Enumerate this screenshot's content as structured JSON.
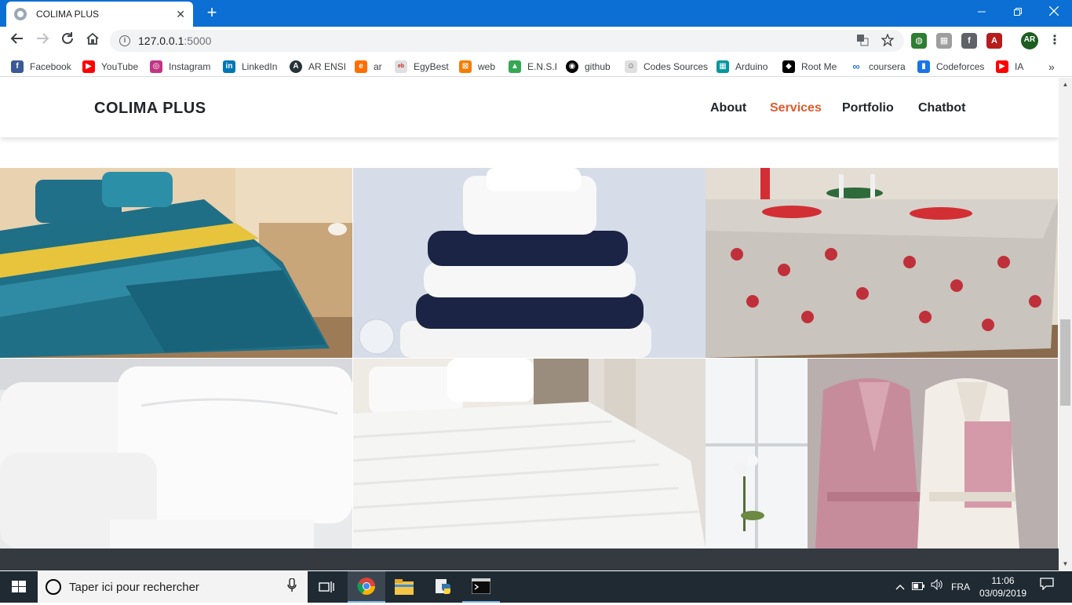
{
  "browser": {
    "tab_title": "COLIMA PLUS",
    "tab_close": "✕",
    "new_tab": "+",
    "url_host": "127.0.0.1",
    "url_port": ":5000",
    "bookmarks": [
      "Facebook",
      "YouTube",
      "Instagram",
      "LinkedIn",
      "AR ENSI",
      "ar",
      "EgyBest",
      "web",
      "E.N.S.I",
      "github",
      "Codes Sources",
      "Arduino",
      "Root Me",
      "coursera",
      "Codeforces",
      "IA"
    ],
    "bookmarks_more": "»",
    "profile_initials": "AR"
  },
  "site": {
    "brand": "COLIMA PLUS",
    "nav": [
      "About",
      "Services",
      "Portfolio",
      "Chatbot"
    ],
    "active_nav": "Services",
    "accent_color": "#e05a2b",
    "gallery_items": [
      "bedding-set",
      "towels",
      "tablecloth",
      "pillows",
      "bed-sheets",
      "bathrobes"
    ]
  },
  "taskbar": {
    "search_placeholder": "Taper ici pour rechercher",
    "language": "FRA",
    "time": "11:06",
    "date": "03/09/2019"
  }
}
